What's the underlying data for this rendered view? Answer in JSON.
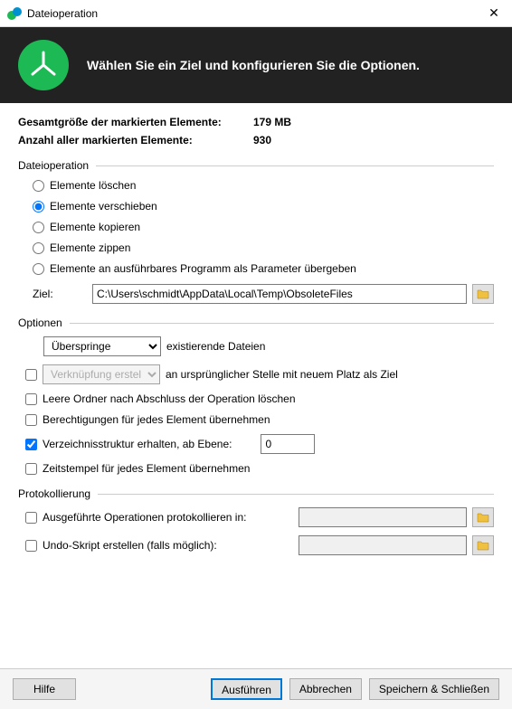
{
  "window": {
    "title": "Dateioperation"
  },
  "header": {
    "text": "Wählen Sie ein Ziel und konfigurieren Sie die Optionen."
  },
  "stats": {
    "size_label": "Gesamtgröße der markierten Elemente:",
    "size_value": "179 MB",
    "count_label": "Anzahl aller markierten Elemente:",
    "count_value": "930"
  },
  "operation": {
    "title": "Dateioperation",
    "radios": {
      "delete": "Elemente löschen",
      "move": "Elemente verschieben",
      "copy": "Elemente kopieren",
      "zip": "Elemente zippen",
      "exec": "Elemente an ausführbares Programm als Parameter übergeben"
    },
    "target_label": "Ziel:",
    "target_value": "C:\\Users\\schmidt\\AppData\\Local\\Temp\\ObsoleteFiles"
  },
  "options": {
    "title": "Optionen",
    "existing_select": "Überspringe",
    "existing_suffix": "existierende Dateien",
    "shortcut_select": "Verknüpfung erstellen",
    "shortcut_suffix": "an ursprünglicher Stelle mit neuem Platz als Ziel",
    "delete_empty": "Leere Ordner nach Abschluss der Operation löschen",
    "permissions": "Berechtigungen für jedes Element übernehmen",
    "preserve_struct": "Verzeichnisstruktur erhalten, ab Ebene:",
    "preserve_level": "0",
    "timestamps": "Zeitstempel für jedes Element übernehmen"
  },
  "logging": {
    "title": "Protokollierung",
    "log_ops": "Ausgeführte Operationen protokollieren in:",
    "undo_script": "Undo-Skript erstellen (falls möglich):"
  },
  "footer": {
    "help": "Hilfe",
    "execute": "Ausführen",
    "cancel": "Abbrechen",
    "save_close": "Speichern & Schließen"
  }
}
